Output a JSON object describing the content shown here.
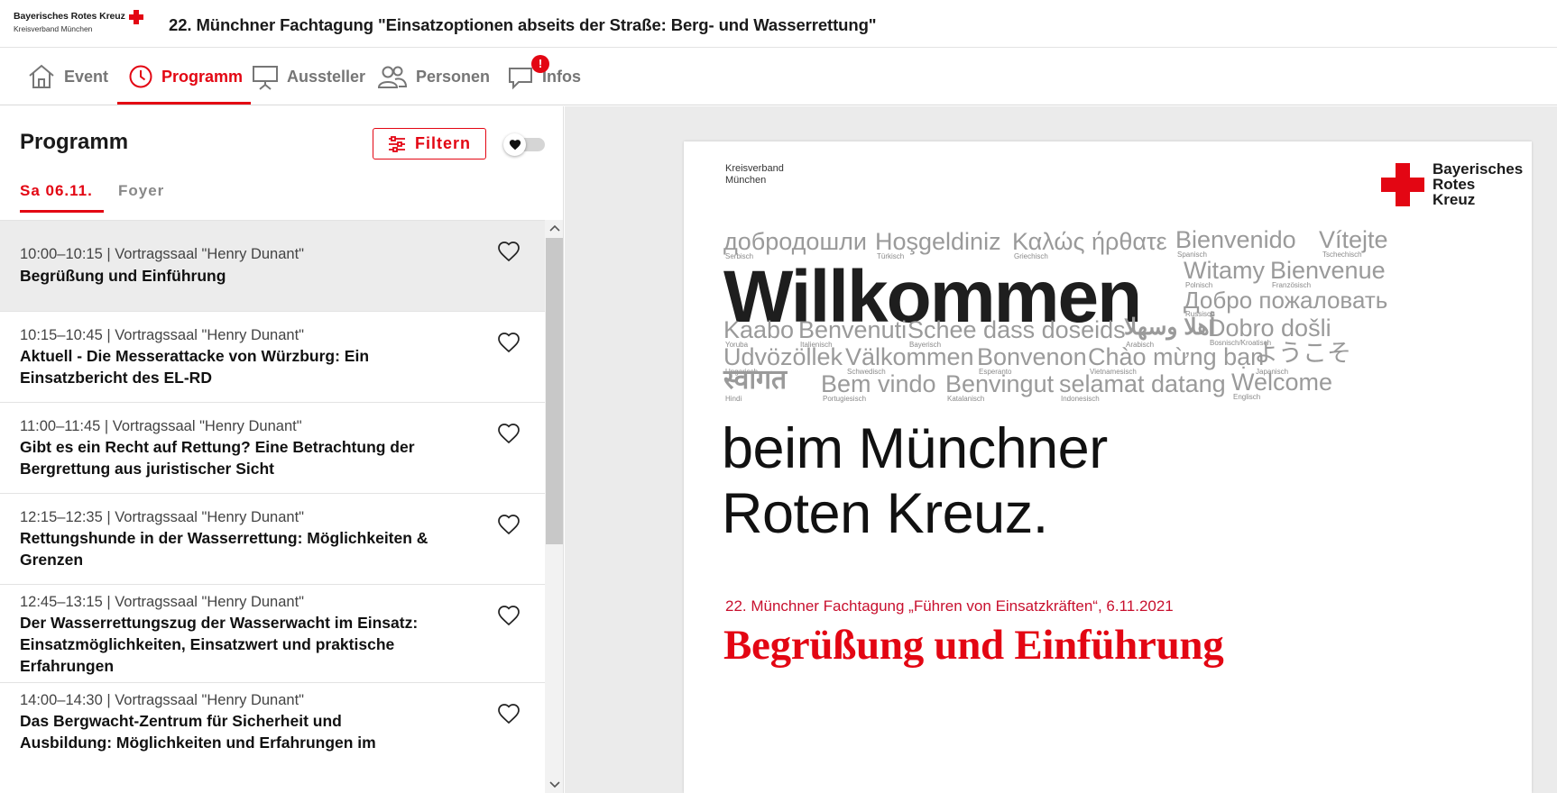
{
  "brand": {
    "name": "Bayerisches Rotes Kreuz",
    "sub": "Kreisverband München"
  },
  "event_title": "22. Münchner Fachtagung \"Einsatzoptionen abseits der Straße: Berg- und Wasserrettung\"",
  "nav": {
    "event": "Event",
    "programm": "Programm",
    "aussteller": "Aussteller",
    "personen": "Personen",
    "infos": "Infos",
    "infos_badge": "!"
  },
  "colors": {
    "accent": "#e30613",
    "inactive": "#767676",
    "selected_row": "#ececec"
  },
  "panel": {
    "title": "Programm",
    "filter_label": "Filtern",
    "tabs": {
      "day": "Sa 06.11.",
      "room": "Foyer"
    }
  },
  "sessions": [
    {
      "meta": "10:00–10:15 | Vortragssaal \"Henry Dunant\"",
      "title": "Begrüßung und Einführung"
    },
    {
      "meta": "10:15–10:45 | Vortragssaal \"Henry Dunant\"",
      "title": "Aktuell - Die Messerattacke von Würzburg: Ein Einsatzbericht des EL-RD"
    },
    {
      "meta": "11:00–11:45 | Vortragssaal \"Henry Dunant\"",
      "title": "Gibt es ein Recht auf Rettung? Eine Betrachtung der Bergrettung aus juristischer Sicht"
    },
    {
      "meta": "12:15–12:35 | Vortragssaal \"Henry Dunant\"",
      "title": "Rettungshunde in der Wasserrettung: Möglichkeiten & Grenzen"
    },
    {
      "meta": "12:45–13:15 | Vortragssaal \"Henry Dunant\"",
      "title": "Der Wasserrettungszug der Wasserwacht im Einsatz: Einsatzmöglichkeiten, Einsatzwert und praktische Erfahrungen"
    },
    {
      "meta": "14:00–14:30 | Vortragssaal \"Henry Dunant\"",
      "title": "Das Bergwacht-Zentrum für Sicherheit und Ausbildung: Möglichkeiten und Erfahrungen im"
    }
  ],
  "slide": {
    "kv_line1": "Kreisverband",
    "kv_line2": "München",
    "logo_line1": "Bayerisches",
    "logo_line2": "Rotes",
    "logo_line3": "Kreuz",
    "welcome": "Willkommen",
    "words": [
      {
        "t": "добродошли",
        "l": "Serbisch"
      },
      {
        "t": "Hoşgeldiniz",
        "l": "Türkisch"
      },
      {
        "t": "Καλώς ήρθατε",
        "l": "Griechisch"
      },
      {
        "t": "Bienvenido",
        "l": "Spanisch"
      },
      {
        "t": "Vítejte",
        "l": "Tschechisch"
      },
      {
        "t": "Witamy",
        "l": "Polnisch"
      },
      {
        "t": "Bienvenue",
        "l": "Französisch"
      },
      {
        "t": "Добро пожаловать",
        "l": "Russisch"
      },
      {
        "t": "Kaabo",
        "l": "Yoruba"
      },
      {
        "t": "Benvenuti",
        "l": "Italienisch"
      },
      {
        "t": "Schee dass doseids",
        "l": "Bayerisch"
      },
      {
        "t": "أهلا وسهلا",
        "l": "Arabisch"
      },
      {
        "t": "Dobro došli",
        "l": "Bosnisch/Kroatisch"
      },
      {
        "t": "Udvözöllek",
        "l": "Ungarisch"
      },
      {
        "t": "Välkommen",
        "l": "Schwedisch"
      },
      {
        "t": "Bonvenon",
        "l": "Esperanto"
      },
      {
        "t": "Chào mừng bạn",
        "l": "Vietnamesisch"
      },
      {
        "t": "ようこそ",
        "l": "Japanisch"
      },
      {
        "t": "स्वागत",
        "l": "Hindi"
      },
      {
        "t": "Bem vindo",
        "l": "Portugiesisch"
      },
      {
        "t": "Benvingut",
        "l": "Katalanisch"
      },
      {
        "t": "selamat datang",
        "l": "Indonesisch"
      },
      {
        "t": "Welcome",
        "l": "Englisch"
      }
    ],
    "line1": "beim Münchner",
    "line2": "Roten Kreuz.",
    "subtitle": "22. Münchner Fachtagung „Führen von Einsatzkräften“, 6.11.2021",
    "title": "Begrüßung und Einführung"
  }
}
